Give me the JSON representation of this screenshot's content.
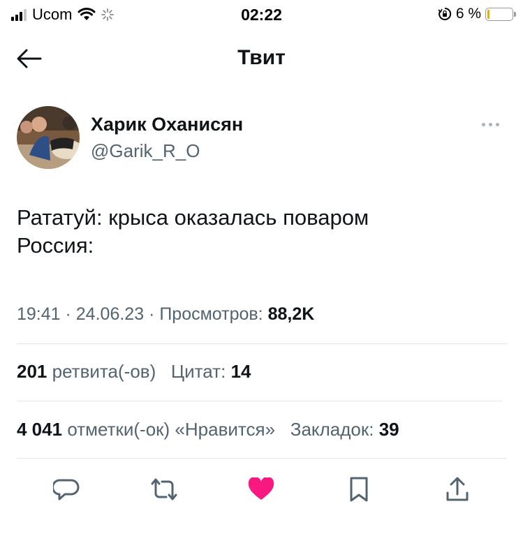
{
  "status_bar": {
    "carrier": "Ucom",
    "time": "02:22",
    "battery_percent": "6 %"
  },
  "header": {
    "title": "Твит"
  },
  "tweet": {
    "author_name": "Харик Оханисян",
    "author_handle": "@Garik_R_O",
    "text_line1": "Рататуй: крыса оказалась поваром",
    "text_line2": "Россия:",
    "time": "19:41",
    "date": "24.06.23",
    "views_label": "Просмотров:",
    "views_count": "88,2K"
  },
  "stats": {
    "retweets_count": "201",
    "retweets_label": "ретвита(-ов)",
    "quotes_label": "Цитат:",
    "quotes_count": "14",
    "likes_count": "4 041",
    "likes_label": "отметки(-ок) «Нравится»",
    "bookmarks_label": "Закладок:",
    "bookmarks_count": "39"
  },
  "icons": {
    "back": "back-arrow-icon",
    "more": "more-icon",
    "reply": "reply-icon",
    "retweet": "retweet-icon",
    "like": "heart-icon",
    "bookmark": "bookmark-icon",
    "share": "share-icon"
  },
  "colors": {
    "like_active": "#f91880",
    "secondary_text": "#536471",
    "primary_text": "#0f1419",
    "divider": "#e3e6e8"
  }
}
